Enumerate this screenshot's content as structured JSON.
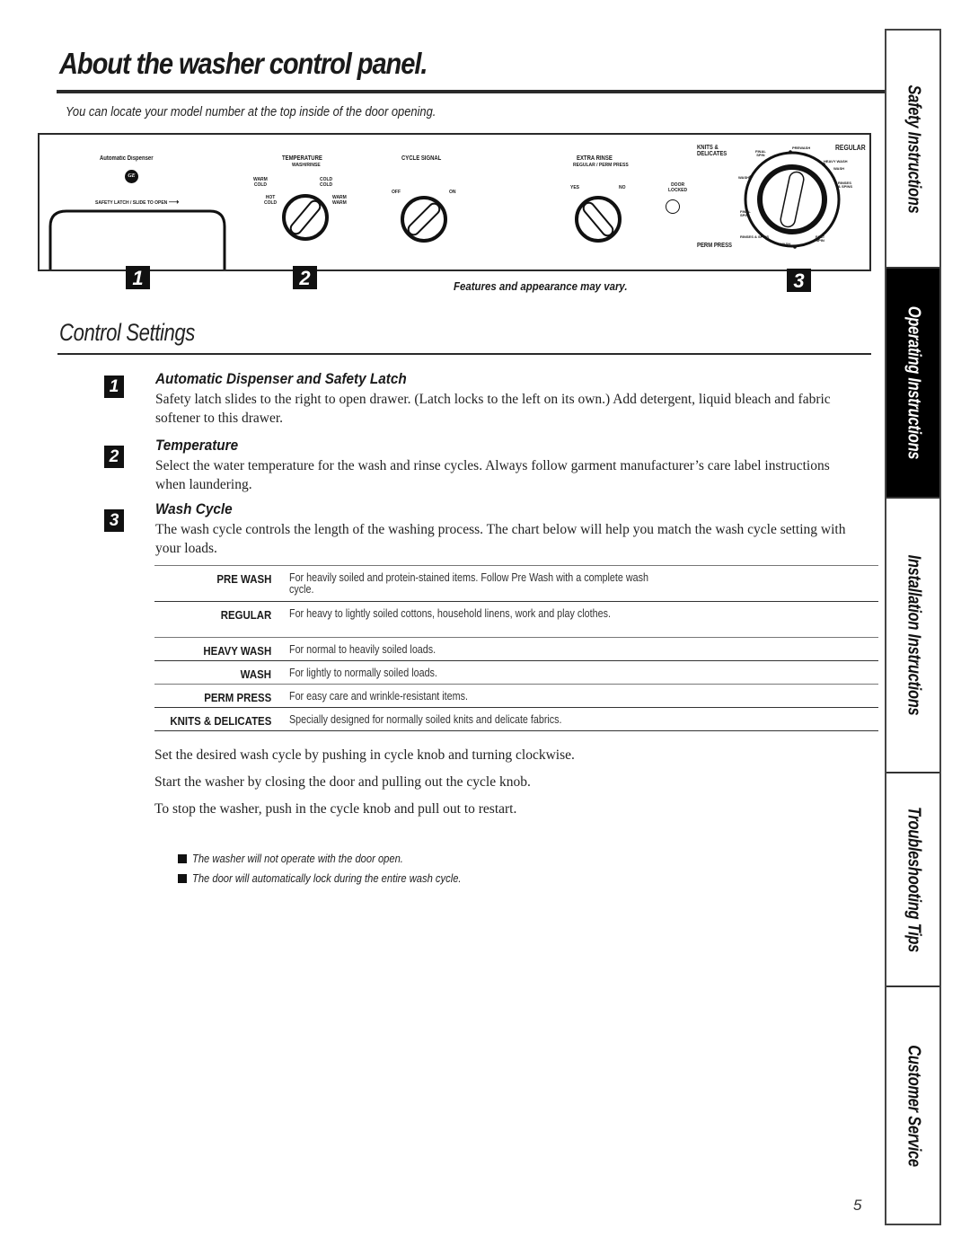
{
  "page": {
    "title": "About the washer control panel.",
    "subtitle": "You can locate your model number at the top inside of the door opening.",
    "page_number": "5"
  },
  "control_panel": {
    "dispenser": {
      "label": "Automatic Dispenser",
      "logo": "GE",
      "latch_label": "SAFETY LATCH / SLIDE TO OPEN"
    },
    "temperature": {
      "label": "TEMPERATURE",
      "sublabel": "WASH/RINSE",
      "positions": [
        "HOT COLD",
        "WARM COLD",
        "COLD COLD",
        "WARM WARM"
      ],
      "pos_hot_cold_1": "HOT",
      "pos_hot_cold_2": "COLD",
      "pos_warm_cold_1": "WARM",
      "pos_warm_cold_2": "COLD",
      "pos_cold_cold_1": "COLD",
      "pos_cold_cold_2": "COLD",
      "pos_warm_warm_1": "WARM",
      "pos_warm_warm_2": "WARM"
    },
    "cycle_signal": {
      "label": "CYCLE SIGNAL",
      "off": "OFF",
      "on": "ON"
    },
    "extra_rinse": {
      "label": "EXTRA RINSE",
      "sublabel": "REGULAR / PERM PRESS",
      "yes": "YES",
      "no": "NO"
    },
    "door_locked": {
      "label_1": "DOOR",
      "label_2": "LOCKED"
    },
    "cycle_dial": {
      "knits_1": "KNITS &",
      "knits_2": "DELICATES",
      "regular": "REGULAR",
      "perm_press": "PERM PRESS",
      "final_spin_top_1": "FINAL",
      "final_spin_top_2": "SPIN",
      "prewash": "PREWASH",
      "heavy_wash": "HEAVY WASH",
      "wash_reg": "WASH",
      "rinses_spins_right_1": "RINSES",
      "rinses_spins_right_2": "& SPINS",
      "wash_left": "WASH",
      "final_spin_left_1": "FINAL",
      "final_spin_left_2": "SPIN",
      "rinses_spins_bottom": "RINSES & SPINS",
      "wash_bottom": "WASH",
      "fast_spin_1": "FAST",
      "fast_spin_2": "SPIN"
    },
    "callouts": [
      "1",
      "2",
      "3"
    ],
    "note": "Features and appearance may vary."
  },
  "control_settings": {
    "title": "Control Settings",
    "items": [
      {
        "number": "1",
        "heading": "Automatic Dispenser and Safety Latch",
        "body": "Safety latch slides to the right to open drawer. (Latch locks to the left on its own.) Add detergent, liquid bleach and fabric softener to this drawer."
      },
      {
        "number": "2",
        "heading": "Temperature",
        "body": "Select the water temperature for the wash and rinse cycles. Always follow garment manufacturer’s care label instructions when laundering."
      },
      {
        "number": "3",
        "heading": "Wash Cycle",
        "body": "The wash cycle controls the length of the washing process. The chart below will help you match the wash cycle setting with your loads."
      }
    ],
    "cycle_table": [
      {
        "name": "PRE WASH",
        "description": "For heavily soiled and protein-stained items. Follow Pre Wash with a complete wash cycle."
      },
      {
        "name": "REGULAR",
        "description": "For heavy to lightly soiled cottons, household linens, work and play clothes."
      },
      {
        "name": "HEAVY WASH",
        "description": "For normal to heavily soiled loads."
      },
      {
        "name": "WASH",
        "description": "For lightly to normally soiled loads."
      },
      {
        "name": "PERM PRESS",
        "description": "For easy care and wrinkle-resistant items."
      },
      {
        "name": "KNITS & DELICATES",
        "description": "Specially designed for normally soiled knits and delicate fabrics."
      }
    ],
    "paragraphs": [
      "Set the desired wash cycle by pushing in cycle knob and turning clockwise.",
      "Start the washer by closing the door and pulling out the cycle knob.",
      "To stop the washer, push in the cycle knob and pull out to restart."
    ],
    "notes": [
      "The washer will not operate with the door open.",
      "The door will automatically lock during the entire wash cycle."
    ]
  },
  "side_tabs": [
    {
      "label": "Safety Instructions",
      "active": false
    },
    {
      "label": "Operating Instructions",
      "active": true
    },
    {
      "label": "Installation Instructions",
      "active": false
    },
    {
      "label": "Troubleshooting Tips",
      "active": false
    },
    {
      "label": "Customer Service",
      "active": false
    }
  ]
}
